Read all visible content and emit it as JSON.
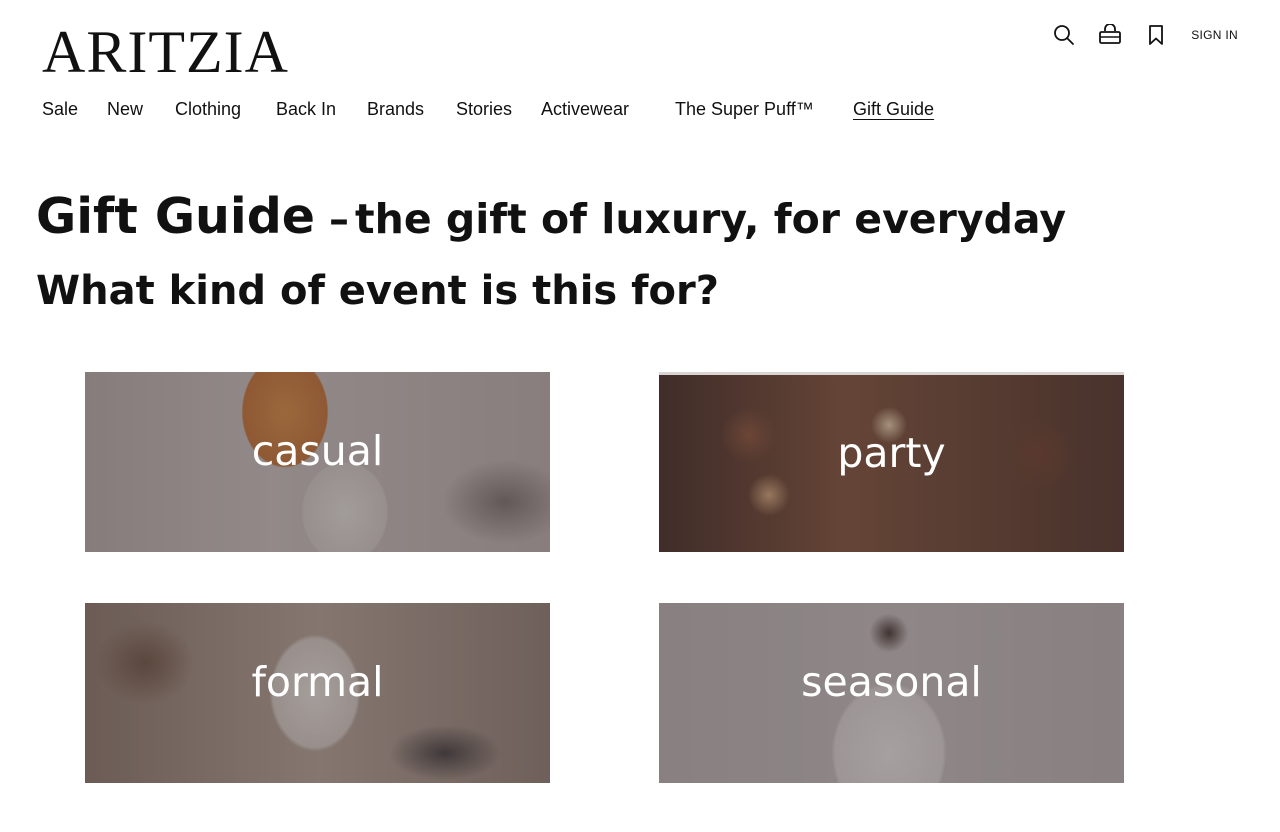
{
  "brand": {
    "logo_text": "ARITZIA"
  },
  "utility": {
    "search_icon": "search-icon",
    "bag_icon": "shopping-bag-icon",
    "bookmark_icon": "bookmark-icon",
    "sign_in_label": "SIGN IN"
  },
  "nav": {
    "items": [
      {
        "label": "Sale"
      },
      {
        "label": "New"
      },
      {
        "label": "Clothing"
      },
      {
        "label": "Back In"
      },
      {
        "label": "Brands"
      },
      {
        "label": "Stories"
      },
      {
        "label": "Activewear"
      },
      {
        "label": "The Super Puff™"
      },
      {
        "label": "Gift Guide"
      }
    ],
    "active": "Gift Guide"
  },
  "page": {
    "title": "Gift Guide",
    "dash": "–",
    "tagline": "the gift of luxury, for everyday",
    "question": "What kind of event is this for?"
  },
  "events": [
    {
      "label": "casual"
    },
    {
      "label": "party"
    },
    {
      "label": "formal"
    },
    {
      "label": "seasonal"
    }
  ],
  "colors": {
    "text": "#111111",
    "tile_overlay": "#463e40",
    "tile_label": "#ffffff"
  }
}
